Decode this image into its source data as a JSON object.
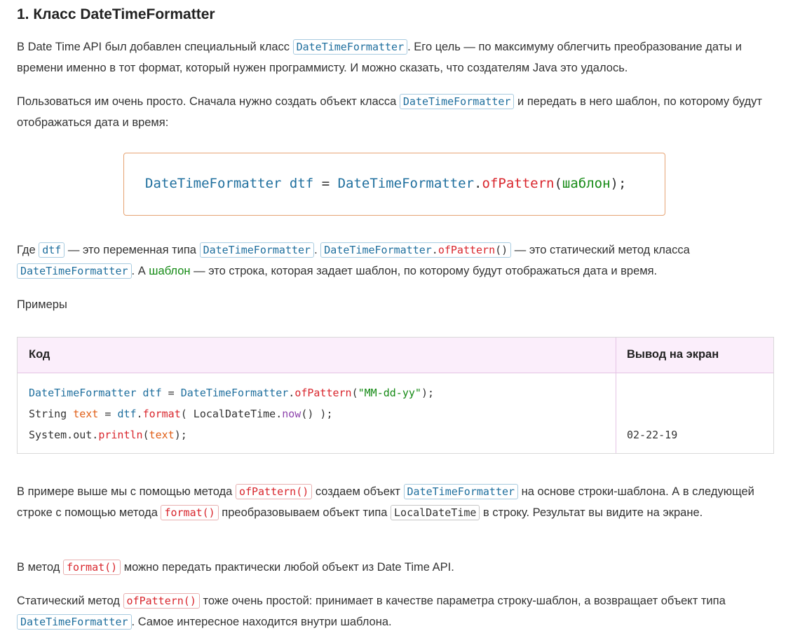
{
  "title": "1. Класс DateTimeFormatter",
  "p1": {
    "t1": "В Date Time API был добавлен специальный класс ",
    "c1": "DateTimeFormatter",
    "t2": ". Его цель — по максимуму облегчить преобразование даты и времени именно в тот формат, который нужен программисту. И можно сказать, что создателям Java это удалось."
  },
  "p2": {
    "t1": "Пользоваться им очень просто. Сначала нужно создать объект класса ",
    "c1": "DateTimeFormatter",
    "t2": " и передать в него шаблон, по которому будут отображаться дата и время:"
  },
  "code_block": {
    "type": "DateTimeFormatter",
    "var": "dtf",
    "eq": " = ",
    "cls": "DateTimeFormatter",
    "dot": ".",
    "method": "ofPattern",
    "open": "(",
    "arg": "шаблон",
    "close": ");"
  },
  "p3": {
    "t1": "Где ",
    "c1": "dtf",
    "t2": " — это переменная типа ",
    "c2": "DateTimeFormatter",
    "t3": ". ",
    "c3_cls": "DateTimeFormatter",
    "c3_dot": ".",
    "c3_method": "ofPattern",
    "c3_parens": "()",
    "t4": " — это статический метод класса ",
    "c4": "DateTimeFormatter",
    "t5": ". А ",
    "w1": "шаблон",
    "t6": " — это строка, которая задает шаблон, по которому будут отображаться дата и время."
  },
  "examples_label": "Примеры",
  "table": {
    "col_code": "Код",
    "col_output": "Вывод на экран",
    "line1": {
      "a": "DateTimeFormatter",
      "b": " dtf",
      "c": " = ",
      "d": "DateTimeFormatter",
      "e": ".",
      "f": "ofPattern",
      "g": "(",
      "h": "\"MM-dd-yy\"",
      "i": ");"
    },
    "line2": {
      "a": "String ",
      "b": "text",
      "c": " = ",
      "d": "dtf",
      "e": ".",
      "f": "format",
      "g": "( LocalDateTime.",
      "h": "now",
      "i": "() );"
    },
    "line3": {
      "a": "System.out.",
      "b": "println",
      "c": "(",
      "d": "text",
      "e": ");"
    },
    "output": "02-22-19"
  },
  "p4": {
    "t1": "В примере выше мы с помощью метода ",
    "c1": "ofPattern()",
    "t2": " создаем объект ",
    "c2": "DateTimeFormatter",
    "t3": " на основе строки-шаблона. А в следующей строке с помощью метода ",
    "c3": "format()",
    "t4": " преобразовываем объект типа ",
    "c4": "LocalDateTime",
    "t5": " в строку. Результат вы видите на экране."
  },
  "p5": {
    "t1": "В метод ",
    "c1": "format()",
    "t2": " можно передать практически любой объект из Date Time API."
  },
  "p6": {
    "t1": "Статический метод ",
    "c1": "ofPattern()",
    "t2": " тоже очень простой: принимает в качестве параметра строку-шаблон, а возвращает объект типа ",
    "c2": "DateTimeFormatter",
    "t3": ". Самое интересное находится внутри шаблона."
  }
}
